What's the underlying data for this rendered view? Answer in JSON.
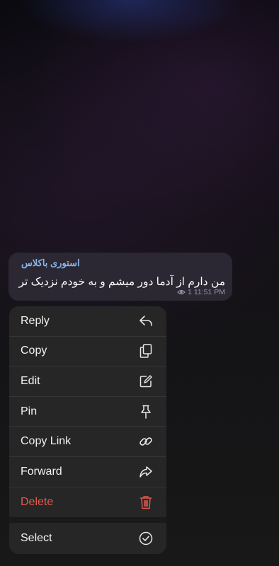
{
  "message": {
    "sender": "استوری باکلاس",
    "text": "من دارم از آدما دور میشم و به خودم نزدیک تر",
    "views": "1",
    "time": "11:51 PM"
  },
  "menu": {
    "items": [
      {
        "label": "Reply",
        "icon": "reply-icon"
      },
      {
        "label": "Copy",
        "icon": "copy-icon"
      },
      {
        "label": "Edit",
        "icon": "edit-icon"
      },
      {
        "label": "Pin",
        "icon": "pin-icon"
      },
      {
        "label": "Copy Link",
        "icon": "link-icon"
      },
      {
        "label": "Forward",
        "icon": "forward-icon"
      },
      {
        "label": "Delete",
        "icon": "trash-icon"
      }
    ],
    "select": {
      "label": "Select",
      "icon": "check-circle-icon"
    }
  },
  "colors": {
    "sender": "#8ab4ea",
    "delete": "#e35b4f",
    "bubble": "#2b2833",
    "menu_bg": "#262626"
  }
}
